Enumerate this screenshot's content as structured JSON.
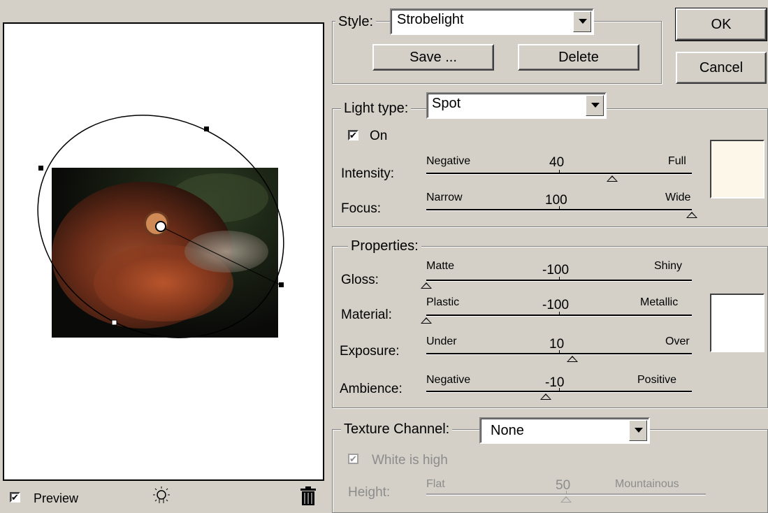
{
  "style": {
    "label": "Style:",
    "value": "Strobelight",
    "save_label": "Save ...",
    "delete_label": "Delete"
  },
  "buttons": {
    "ok": "OK",
    "cancel": "Cancel"
  },
  "light": {
    "type_label": "Light type:",
    "type_value": "Spot",
    "on_label": "On",
    "on_checked": true,
    "color": "#fcf7e8",
    "intensity": {
      "label": "Intensity:",
      "min_label": "Negative",
      "max_label": "Full",
      "value": "40",
      "min": -100,
      "max": 100
    },
    "focus": {
      "label": "Focus:",
      "min_label": "Narrow",
      "max_label": "Wide",
      "value": "100",
      "min": -100,
      "max": 100
    }
  },
  "properties": {
    "legend": "Properties:",
    "color": "#ffffff",
    "gloss": {
      "label": "Gloss:",
      "min_label": "Matte",
      "max_label": "Shiny",
      "value": "-100",
      "min": -100,
      "max": 100
    },
    "material": {
      "label": "Material:",
      "min_label": "Plastic",
      "max_label": "Metallic",
      "value": "-100",
      "min": -100,
      "max": 100
    },
    "exposure": {
      "label": "Exposure:",
      "min_label": "Under",
      "max_label": "Over",
      "value": "10",
      "min": -100,
      "max": 100
    },
    "ambience": {
      "label": "Ambience:",
      "min_label": "Negative",
      "max_label": "Positive",
      "value": "-10",
      "min": -100,
      "max": 100
    }
  },
  "texture": {
    "label": "Texture Channel:",
    "value": "None",
    "white_is_high_label": "White is high",
    "white_is_high_checked": true,
    "height": {
      "label": "Height:",
      "min_label": "Flat",
      "max_label": "Mountainous",
      "value": "50",
      "min": 0,
      "max": 100
    }
  },
  "preview": {
    "label": "Preview",
    "checked": true
  },
  "icons": {
    "light": "lightbulb-icon",
    "trash": "trash-icon"
  }
}
